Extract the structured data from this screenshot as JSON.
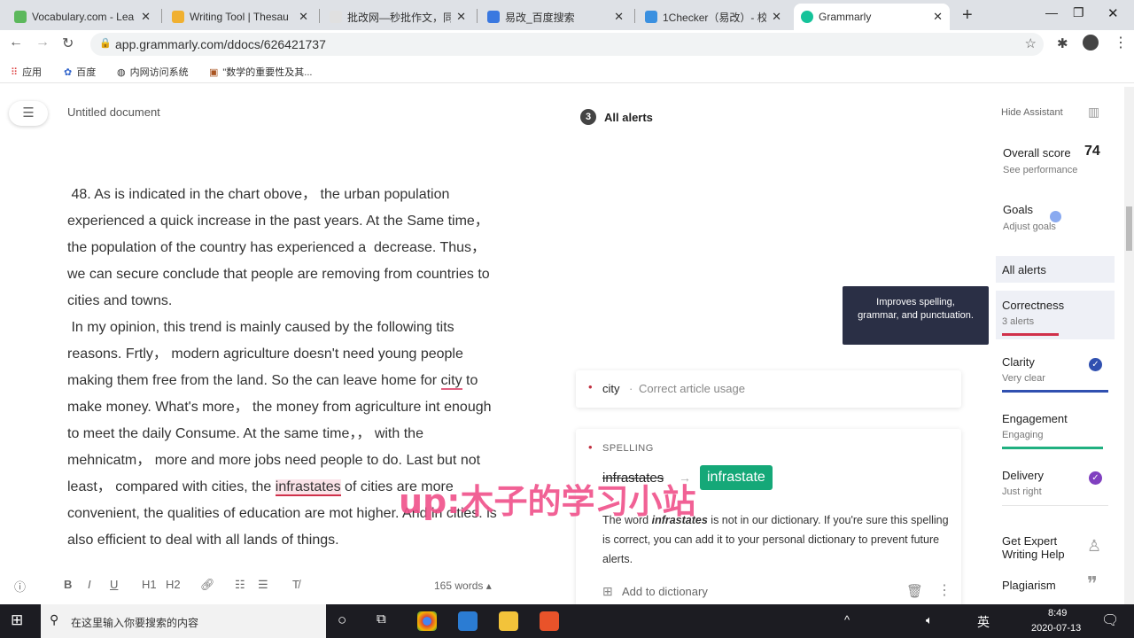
{
  "browser": {
    "tabs": [
      {
        "label": "Vocabulary.com - Lea",
        "color": "#5cb85c"
      },
      {
        "label": "Writing Tool | Thesau",
        "color": "#f0b030"
      },
      {
        "label": "批改网—秒批作文，同",
        "color": "#e0e0e0"
      },
      {
        "label": "易改_百度搜索",
        "color": "#3a78e0"
      },
      {
        "label": "1Checker（易改）- 校",
        "color": "#3a90e0"
      },
      {
        "label": "Grammarly",
        "color": "#15c39a"
      }
    ],
    "url": "app.grammarly.com/ddocs/626421737",
    "bookmarks": [
      "应用",
      "百度",
      "内网访问系统",
      "\"数学的重要性及其..."
    ]
  },
  "doc": {
    "title": "Untitled document",
    "lines": [
      [
        {
          "t": " 48. As is indicated in the chart obove， the urban population"
        }
      ],
      [
        {
          "t": "experienced a quick increase in the past years. At the Same time，"
        }
      ],
      [
        {
          "t": "the population of the country has experienced a  decrease. Thus，"
        }
      ],
      [
        {
          "t": "we can secure conclude that people are removing from countries to"
        }
      ],
      [
        {
          "t": "cities and towns."
        }
      ],
      [
        {
          "t": " In my opinion, this trend is mainly caused by the following tits"
        }
      ],
      [
        {
          "t": "reasons. Frtly， modern agriculture doesn't need young people"
        }
      ],
      [
        {
          "t": "making them free from the land. So the can leave home for "
        },
        {
          "t": "city",
          "m": "u"
        },
        {
          "t": " to"
        }
      ],
      [
        {
          "t": "make money. What's more， the money from agriculture int enough"
        }
      ],
      [
        {
          "t": "to meet the daily Consume. At the same time，， with the"
        }
      ],
      [
        {
          "t": "mehnicatm， more and more jobs need people to do. Last but not"
        }
      ],
      [
        {
          "t": "least， compared with cities, the "
        },
        {
          "t": "infrastates",
          "m": "h"
        },
        {
          "t": " of cities are more"
        }
      ],
      [
        {
          "t": "convenient, the qualities of education are mot higher. And in cities. is"
        }
      ],
      [
        {
          "t": "also efficient to deal with all lands of things."
        }
      ]
    ],
    "word_count": "165 words ▴",
    "toolbar": [
      "B",
      "I",
      "U",
      "H1",
      "H2"
    ]
  },
  "alerts": {
    "count": "3",
    "header": "All alerts",
    "city_card": {
      "word": "city",
      "sep": "·",
      "desc": "Correct article usage"
    },
    "spelling_card": {
      "category": "SPELLING",
      "original": "infrastates",
      "arrow": "→",
      "suggestion": "infrastate",
      "body_pre": "The word ",
      "body_word": "infrastates",
      "body_post": " is not in our dictionary. If you're sure this spelling is correct, you can add it to your personal dictionary to prevent future alerts.",
      "add_label": "Add to dictionary"
    },
    "tooltip": "Improves spelling, grammar, and punctuation."
  },
  "assistant": {
    "hide_label": "Hide Assistant",
    "overall_label": "Overall score",
    "overall_score": "74",
    "see_performance": "See performance",
    "goals": "Goals",
    "adjust_goals": "Adjust goals",
    "all_alerts": "All alerts",
    "categories": [
      {
        "name": "Correctness",
        "sub": "3 alerts",
        "color": "#d0304a"
      },
      {
        "name": "Clarity",
        "sub": "Very clear",
        "color": "#3050b0"
      },
      {
        "name": "Engagement",
        "sub": "Engaging",
        "color": "#20b080"
      },
      {
        "name": "Delivery",
        "sub": "Just right",
        "color": "#8040c0"
      }
    ],
    "expert": "Get Expert Writing Help",
    "plagiarism": "Plagiarism"
  },
  "watermark": "up:木子的学习小站",
  "taskbar": {
    "search": "在这里输入你要搜索的内容",
    "time": "8:49",
    "date": "2020-07-13",
    "ime": "英"
  }
}
